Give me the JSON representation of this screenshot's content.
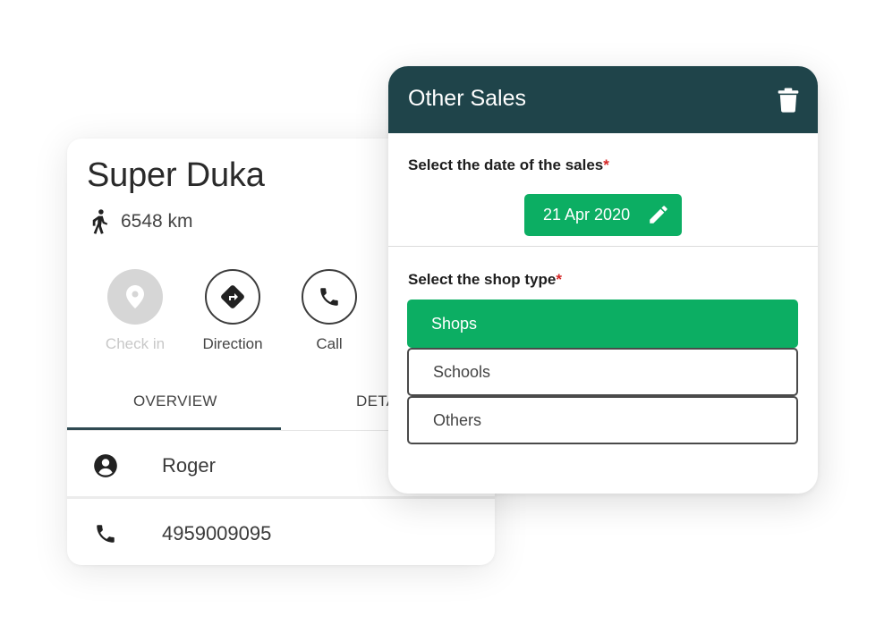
{
  "shop": {
    "name": "Super Duka",
    "distance": "6548 km",
    "actions": [
      {
        "label": "Check in",
        "icon": "location-pin-icon",
        "enabled": false
      },
      {
        "label": "Direction",
        "icon": "direction-icon",
        "enabled": true
      },
      {
        "label": "Call",
        "icon": "phone-icon",
        "enabled": true
      }
    ],
    "tabs": [
      "OVERVIEW",
      "DETA"
    ],
    "active_tab": "OVERVIEW",
    "contact_name": "Roger",
    "phone": "4959009095"
  },
  "dialog": {
    "title": "Other Sales",
    "date_label": "Select the date of the sales",
    "required_mark": "*",
    "date_value": "21 Apr 2020",
    "shop_type_label": "Select the shop type",
    "options": [
      "Shops",
      "Schools",
      "Others"
    ],
    "selected_option": "Shops"
  },
  "colors": {
    "header": "#1f444a",
    "accent_green": "#0cae63",
    "required": "#d42626"
  }
}
